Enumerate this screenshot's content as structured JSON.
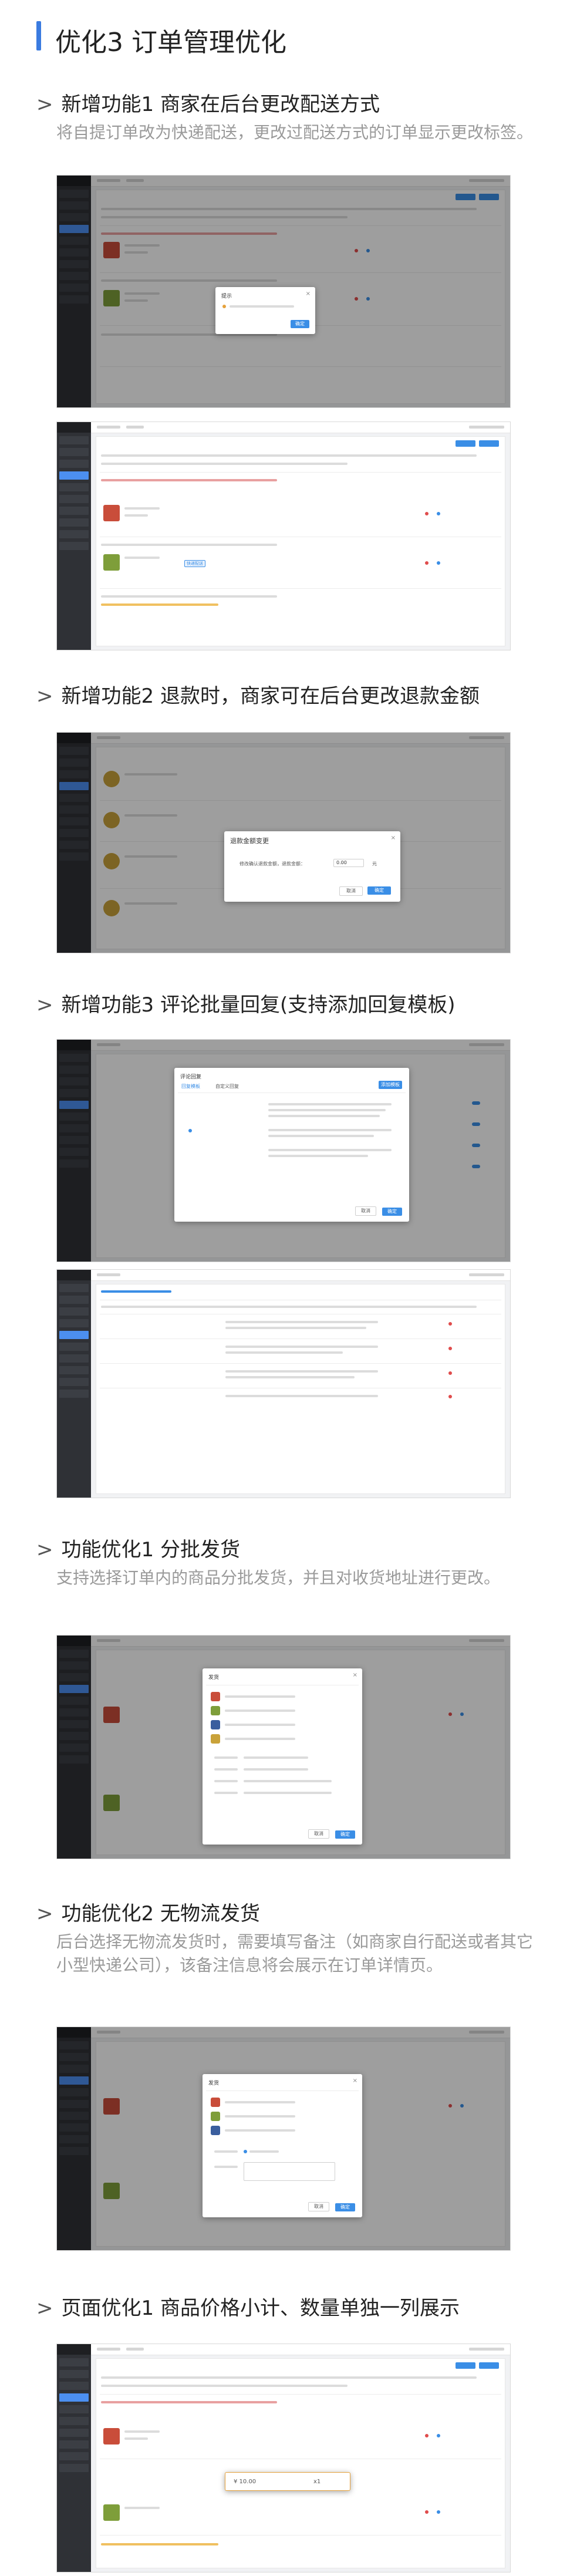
{
  "title": "优化3 订单管理优化",
  "sections": [
    {
      "heading": "新增功能1 商家在后台更改配送方式",
      "description": "将自提订单改为快递配送，更改过配送方式的订单显示更改标签。",
      "dialog": {
        "title": "提示",
        "close": "×",
        "ok": "确定",
        "tag": "快递配送"
      }
    },
    {
      "heading": "新增功能2 退款时，商家可在后台更改退款金额",
      "dialog": {
        "title": "退款金额变更",
        "close": "×",
        "label": "修改确认退款金额，退款金额：",
        "value": "0.00",
        "unit": "元",
        "cancel": "取消",
        "ok": "确定"
      }
    },
    {
      "heading": "新增功能3 评论批量回复(支持添加回复模板)",
      "dialog": {
        "title": "评论回复",
        "tab1": "回复模板",
        "tab2": "自定义回复",
        "add": "添加模板",
        "cancel": "取消",
        "ok": "确定"
      }
    },
    {
      "heading": "功能优化1 分批发货",
      "description": "支持选择订单内的商品分批发货，并且对收货地址进行更改。",
      "dialog": {
        "title": "发货",
        "cancel": "取消",
        "ok": "确定"
      }
    },
    {
      "heading": "功能优化2 无物流发货",
      "description": "后台选择无物流发货时，需要填写备注（如商家自行配送或者其它小型快递公司），该备注信息将会展示在订单详情页。",
      "dialog": {
        "title": "发货",
        "cancel": "取消",
        "ok": "确定"
      }
    },
    {
      "heading": "页面优化1 商品价格小计、数量单独一列展示",
      "callout": {
        "price": "¥ 10.00",
        "qty": "x1"
      }
    }
  ],
  "arrow": ">",
  "colors": {
    "accent": "#3a7be0",
    "primary_button": "#3a8ee6",
    "sidebar": "#2f3136"
  }
}
